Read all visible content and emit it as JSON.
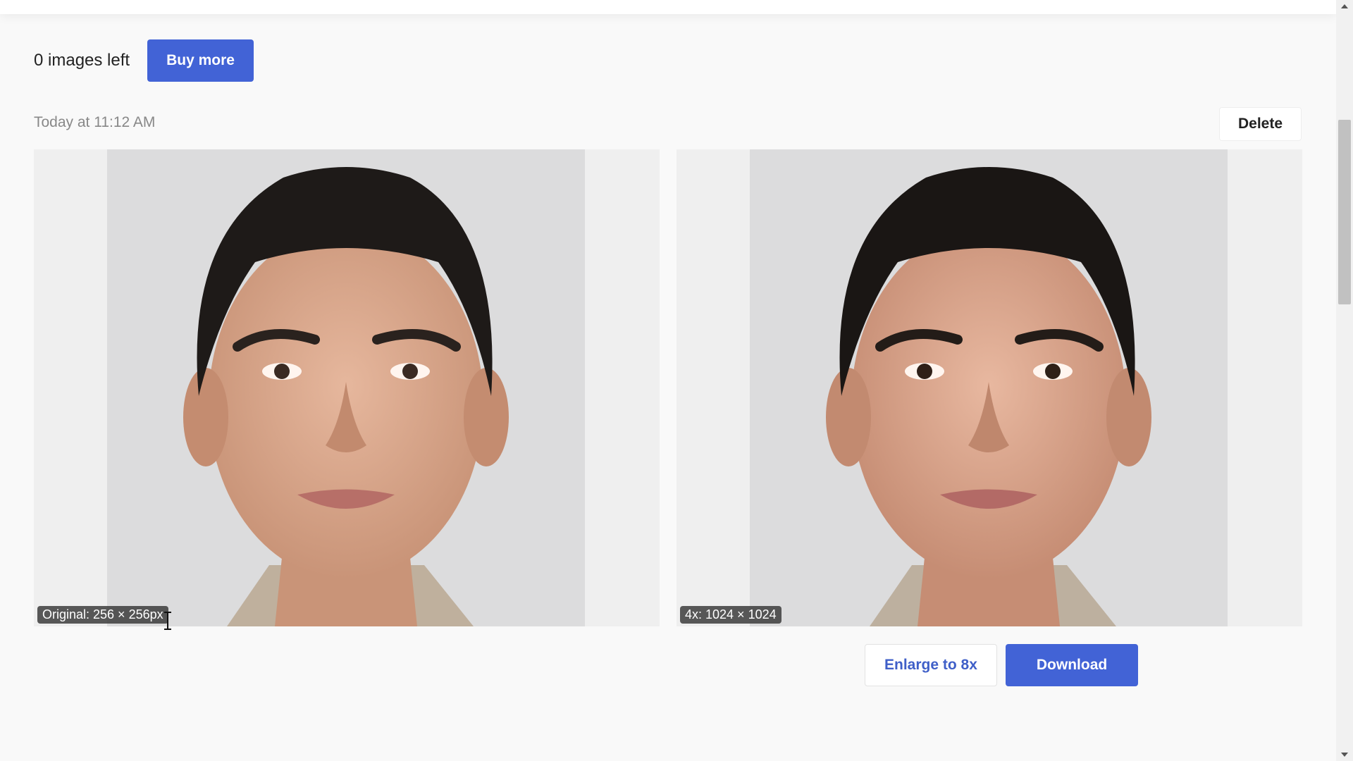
{
  "credits": {
    "remaining_text": "0 images left",
    "buy_more_label": "Buy more"
  },
  "item": {
    "timestamp": "Today at 11:12 AM",
    "delete_label": "Delete",
    "original": {
      "label": "Original: 256 × 256px",
      "image_icon": "face-portrait-original"
    },
    "enlarged": {
      "label": "4x: 1024 × 1024",
      "image_icon": "face-portrait-enlarged"
    },
    "enlarge_label": "Enlarge to 8x",
    "download_label": "Download"
  },
  "colors": {
    "accent": "#4263d6",
    "page_bg": "#f9f9f9"
  }
}
